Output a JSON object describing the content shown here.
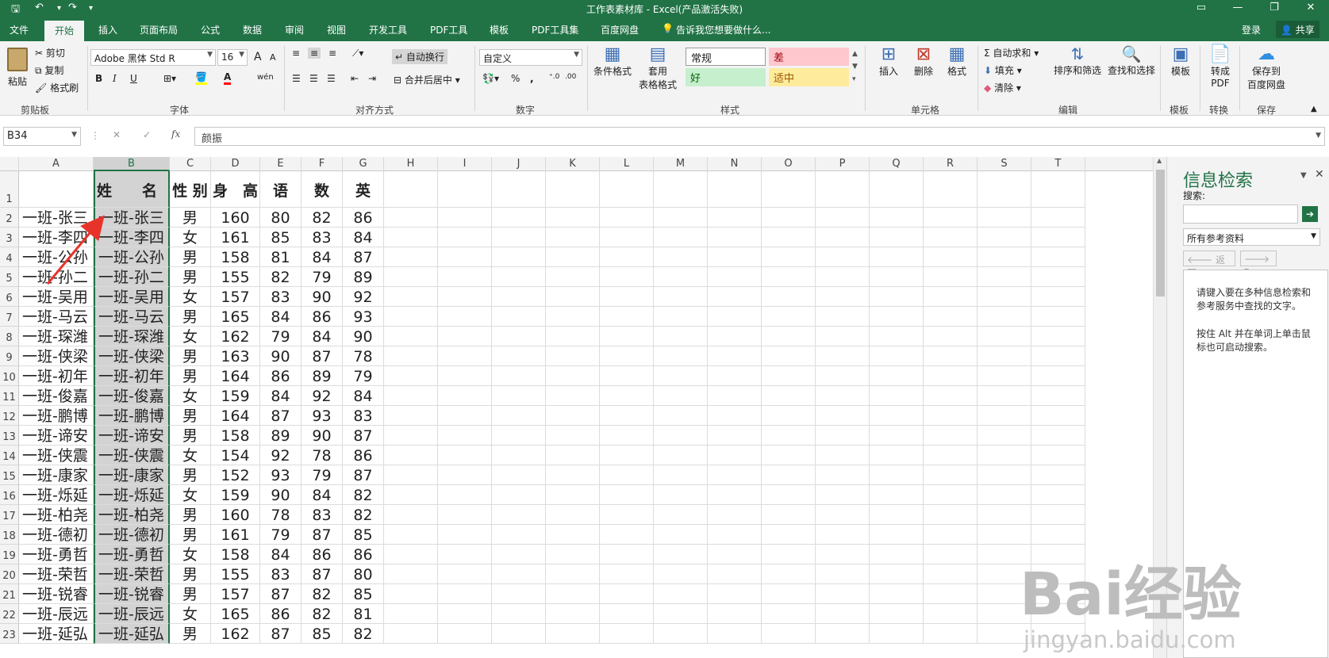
{
  "titlebar": {
    "title": "工作表素材库 - Excel(产品激活失败)",
    "qa_icons": [
      "save-icon",
      "undo-icon",
      "redo-icon",
      "customize-icon"
    ]
  },
  "tabs": [
    "文件",
    "开始",
    "插入",
    "页面布局",
    "公式",
    "数据",
    "审阅",
    "视图",
    "开发工具",
    "PDF工具",
    "模板",
    "PDF工具集",
    "百度网盘"
  ],
  "tell_me": "告诉我您想要做什么...",
  "login": "登录",
  "share": "共享",
  "ribbon": {
    "clipboard": {
      "paste": "粘贴",
      "cut": "剪切",
      "copy": "复制",
      "format_painter": "格式刷",
      "label": "剪贴板"
    },
    "font": {
      "name": "Adobe 黑体 Std R",
      "size": "16",
      "label": "字体",
      "bold": "B",
      "italic": "I",
      "underline": "U",
      "grow": "A",
      "shrink": "A",
      "font_color": "A",
      "phonetic": "wén"
    },
    "alignment": {
      "wrap_text": "自动换行",
      "merge_center": "合并后居中",
      "label": "对齐方式"
    },
    "number": {
      "format": "自定义",
      "percent": "%",
      "comma": ",",
      "label": "数字"
    },
    "styles": {
      "conditional": "条件格式",
      "table_format_l1": "套用",
      "table_format_l2": "表格格式",
      "normal": "常规",
      "bad": "差",
      "good": "好",
      "neutral": "适中",
      "label": "样式"
    },
    "cells": {
      "insert": "插入",
      "delete": "删除",
      "format": "格式",
      "label": "单元格"
    },
    "editing": {
      "autosum": "自动求和",
      "fill": "填充",
      "clear": "清除",
      "sort_filter": "排序和筛选",
      "find_select": "查找和选择",
      "label": "编辑"
    },
    "template": {
      "btn": "模板",
      "label": "模板"
    },
    "convert": {
      "btn_l1": "转成",
      "btn_l2": "PDF",
      "label": "转换"
    },
    "save": {
      "btn_l1": "保存到",
      "btn_l2": "百度网盘",
      "label": "保存"
    }
  },
  "formula_bar": {
    "name_box": "B34",
    "fx": "fx",
    "content": "颜振"
  },
  "grid": {
    "columns": [
      "A",
      "B",
      "C",
      "D",
      "E",
      "F",
      "G",
      "H",
      "I",
      "J",
      "K",
      "L",
      "M",
      "N",
      "O",
      "P",
      "Q",
      "R",
      "S",
      "T"
    ],
    "selected_column": "B",
    "row_numbers": [
      "1",
      "2",
      "3",
      "4",
      "5",
      "6",
      "7",
      "8",
      "9",
      "10",
      "11",
      "12",
      "13",
      "14",
      "15",
      "16",
      "17",
      "18",
      "19",
      "20",
      "21",
      "22",
      "23"
    ],
    "header_row": [
      "",
      "姓　　名",
      "性 别",
      "身　高",
      "语",
      "数",
      "英"
    ],
    "rows": [
      [
        "一班-张三",
        "一班-张三",
        "男",
        "160",
        "80",
        "82",
        "86"
      ],
      [
        "一班-李四",
        "一班-李四",
        "女",
        "161",
        "85",
        "83",
        "84"
      ],
      [
        "一班-公孙",
        "一班-公孙",
        "男",
        "158",
        "81",
        "84",
        "87"
      ],
      [
        "一班-孙二",
        "一班-孙二",
        "男",
        "155",
        "82",
        "79",
        "89"
      ],
      [
        "一班-吴用",
        "一班-吴用",
        "女",
        "157",
        "83",
        "90",
        "92"
      ],
      [
        "一班-马云",
        "一班-马云",
        "男",
        "165",
        "84",
        "86",
        "93"
      ],
      [
        "一班-琛潍",
        "一班-琛潍",
        "女",
        "162",
        "79",
        "84",
        "90"
      ],
      [
        "一班-侠梁",
        "一班-侠梁",
        "男",
        "163",
        "90",
        "87",
        "78"
      ],
      [
        "一班-初年",
        "一班-初年",
        "男",
        "164",
        "86",
        "89",
        "79"
      ],
      [
        "一班-俊嘉",
        "一班-俊嘉",
        "女",
        "159",
        "84",
        "92",
        "84"
      ],
      [
        "一班-鹏博",
        "一班-鹏博",
        "男",
        "164",
        "87",
        "93",
        "83"
      ],
      [
        "一班-谛安",
        "一班-谛安",
        "男",
        "158",
        "89",
        "90",
        "87"
      ],
      [
        "一班-侠震",
        "一班-侠震",
        "女",
        "154",
        "92",
        "78",
        "86"
      ],
      [
        "一班-康家",
        "一班-康家",
        "男",
        "152",
        "93",
        "79",
        "87"
      ],
      [
        "一班-烁延",
        "一班-烁延",
        "女",
        "159",
        "90",
        "84",
        "82"
      ],
      [
        "一班-柏尧",
        "一班-柏尧",
        "男",
        "160",
        "78",
        "83",
        "82"
      ],
      [
        "一班-德初",
        "一班-德初",
        "男",
        "161",
        "79",
        "87",
        "85"
      ],
      [
        "一班-勇哲",
        "一班-勇哲",
        "女",
        "158",
        "84",
        "86",
        "86"
      ],
      [
        "一班-荣哲",
        "一班-荣哲",
        "男",
        "155",
        "83",
        "87",
        "80"
      ],
      [
        "一班-锐睿",
        "一班-锐睿",
        "男",
        "157",
        "87",
        "82",
        "85"
      ],
      [
        "一班-辰远",
        "一班-辰远",
        "女",
        "165",
        "86",
        "82",
        "81"
      ],
      [
        "一班-延弘",
        "一班-延弘",
        "男",
        "162",
        "87",
        "85",
        "82"
      ]
    ]
  },
  "pane": {
    "title": "信息检索",
    "search_label": "搜索:",
    "source": "所有参考资料",
    "back": "返回",
    "help1": "请键入要在多种信息检索和参考服务中查找的文字。",
    "help2": "按住 Alt 并在单词上单击鼠标也可启动搜索。"
  },
  "watermark": {
    "main": "Bai经验",
    "sub": "jingyan.baidu.com"
  },
  "colors": {
    "accent": "#217346",
    "bad_bg": "#ffc7ce",
    "bad_fg": "#9c0006",
    "good_bg": "#c6efce",
    "good_fg": "#006100",
    "neutral_bg": "#ffeb9c",
    "neutral_fg": "#9c5700",
    "arrow": "#e8332a"
  }
}
